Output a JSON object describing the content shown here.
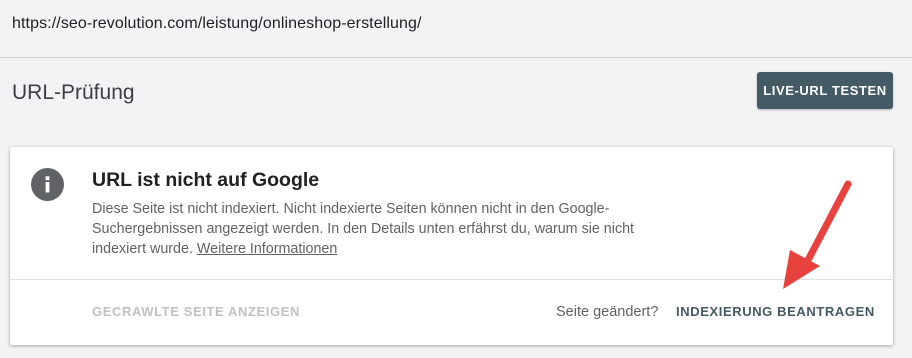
{
  "url_bar": {
    "url": "https://seo-revolution.com/leistung/onlineshop-erstellung/"
  },
  "header": {
    "title": "URL-Prüfung",
    "live_test_label": "LIVE-URL TESTEN"
  },
  "status_card": {
    "icon": "info-icon",
    "title": "URL ist nicht auf Google",
    "description": "Diese Seite ist nicht indexiert. Nicht indexierte Seiten können nicht in den Google-Suchergebnissen angezeigt werden. In den Details unten erfährst du, warum sie nicht indexiert wurde. ",
    "more_info_link": "Weitere Informationen",
    "crawled_page_label": "GECRAWLTE SEITE ANZEIGEN",
    "page_changed_label": "Seite geändert?",
    "request_indexing_label": "INDEXIERUNG BEANTRAGEN"
  },
  "annotation": {
    "icon": "red-arrow-icon",
    "color": "#e8423f"
  },
  "colors": {
    "background": "#f1f3f4",
    "primary_button": "#445a64",
    "disabled_text": "#bdc1c6",
    "secondary_text": "#5f6368"
  }
}
